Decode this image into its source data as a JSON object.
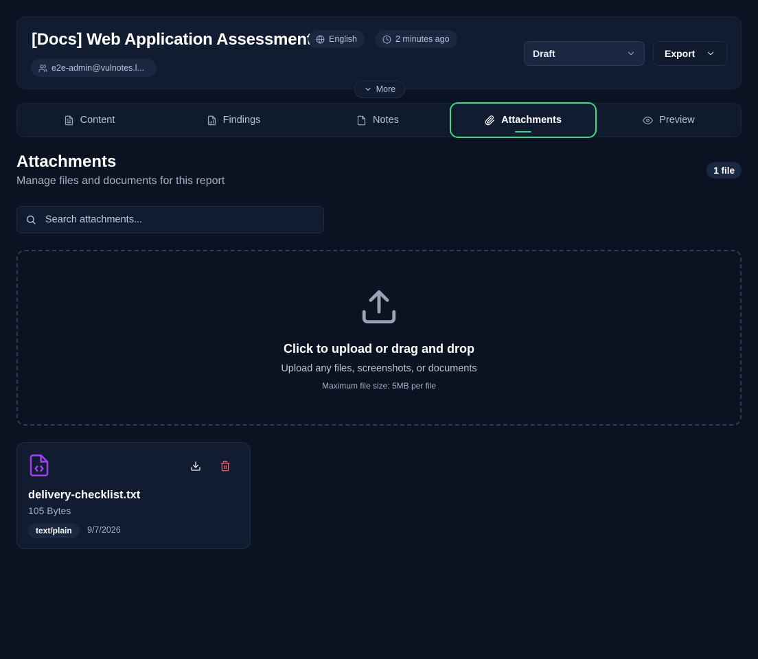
{
  "header": {
    "title": "[Docs] Web Application Assessment",
    "language": "English",
    "updated": "2 minutes ago",
    "user": "e2e-admin@vulnotes.l...",
    "status": "Draft",
    "export_label": "Export",
    "more_label": "More"
  },
  "tabs": [
    {
      "label": "Content",
      "icon": "file-text-icon"
    },
    {
      "label": "Findings",
      "icon": "file-chart-icon"
    },
    {
      "label": "Notes",
      "icon": "file-icon"
    },
    {
      "label": "Attachments",
      "icon": "paperclip-icon",
      "active": true
    },
    {
      "label": "Preview",
      "icon": "eye-icon"
    }
  ],
  "section": {
    "title": "Attachments",
    "subtitle": "Manage files and documents for this report",
    "count": "1 file"
  },
  "search": {
    "placeholder": "Search attachments..."
  },
  "dropzone": {
    "title": "Click to upload or drag and drop",
    "subtitle": "Upload any files, screenshots, or documents",
    "limit": "Maximum file size: 5MB per file"
  },
  "files": [
    {
      "name": "delivery-checklist.txt",
      "size": "105 Bytes",
      "mime": "text/plain",
      "date": "9/7/2026",
      "icon": "file-code-icon"
    }
  ],
  "colors": {
    "background": "#0b1322",
    "accent": "#3ddc84",
    "file_icon": "#a03ff0",
    "danger": "#f05a6b"
  }
}
